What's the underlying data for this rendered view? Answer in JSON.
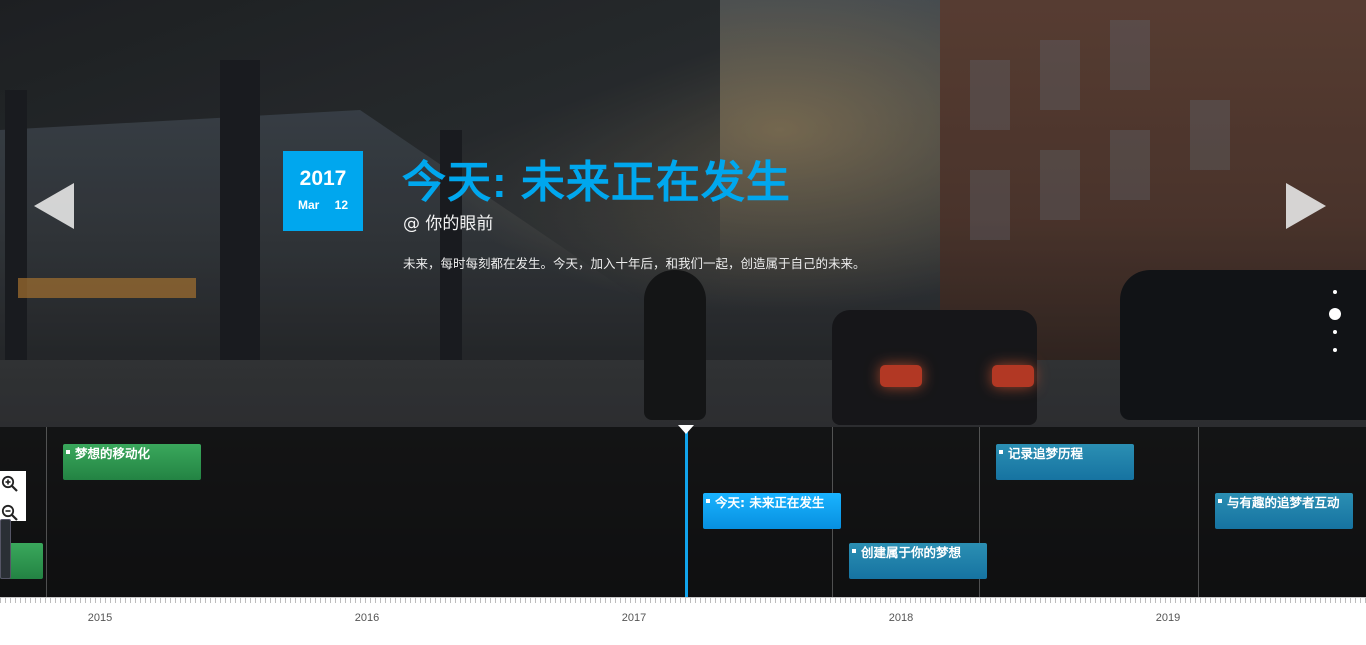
{
  "slide": {
    "year": "2017",
    "month": "Mar",
    "day": "12",
    "title": "今天: 未来正在发生",
    "subtitle": "@ 你的眼前",
    "description": "未来，每时每刻都在发生。今天，加入十年后，和我们一起，创造属于自己的未来。"
  },
  "navigation": {
    "prev_icon": "triangle-left-icon",
    "next_icon": "triangle-right-icon",
    "dots_count": 4,
    "active_dot": 1
  },
  "timeline": {
    "events": [
      {
        "label": "梦想的移动化",
        "color": "green"
      },
      {
        "label": "",
        "color": "green"
      },
      {
        "label": "今天: 未来正在发生",
        "color": "blue"
      },
      {
        "label": "创建属于你的梦想",
        "color": "teal"
      },
      {
        "label": "记录追梦历程",
        "color": "teal"
      },
      {
        "label": "与有趣的追梦者互动",
        "color": "teal"
      }
    ],
    "axis_labels": [
      "2015",
      "2016",
      "2017",
      "2018",
      "2019"
    ],
    "zoom_in_icon": "zoom-in-icon",
    "zoom_out_icon": "zoom-out-icon"
  },
  "colors": {
    "accent": "#00a7ee",
    "flag_green": "#2e9a50",
    "flag_teal": "#1d80aa",
    "flag_blue": "#0ea2f0"
  }
}
